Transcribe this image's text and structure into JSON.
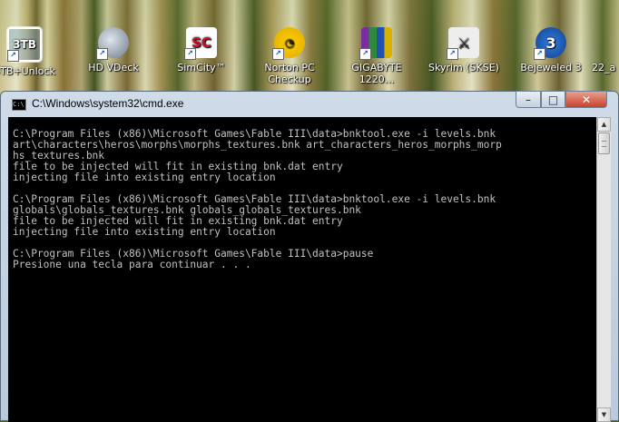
{
  "desktop": {
    "icons": [
      {
        "label": "3TB+Unlock",
        "glyph": "3TB",
        "icon": "3tb-unlock-icon"
      },
      {
        "label": "HD VDeck",
        "glyph": "",
        "icon": "hd-vdeck-icon"
      },
      {
        "label": "SimCity™",
        "glyph": "SC",
        "icon": "simcity-icon"
      },
      {
        "label": "Norton PC Checkup",
        "glyph": "◔",
        "icon": "norton-icon"
      },
      {
        "label": "GIGABYTE 1220...",
        "glyph": "",
        "icon": "gigabyte-icon"
      },
      {
        "label": "Skyrim (SKSE)",
        "glyph": "⚔",
        "icon": "skyrim-icon"
      },
      {
        "label": "Bejeweled 3",
        "glyph": "3",
        "icon": "bejeweled-icon"
      },
      {
        "label": "22_a",
        "glyph": "",
        "icon": "file-icon"
      }
    ]
  },
  "window": {
    "title": "C:\\Windows\\system32\\cmd.exe",
    "title_icon": "C:\\",
    "buttons": {
      "minimize": "–",
      "maximize": "□",
      "close": "✕"
    }
  },
  "console": {
    "text": "C:\\Program Files (x86)\\Microsoft Games\\Fable III\\data>bnktool.exe -i levels.bnk\nart\\characters\\heros\\morphs\\morphs_textures.bnk art_characters_heros_morphs_morp\nhs_textures.bnk\nfile to be injected will fit in existing bnk.dat entry\ninjecting file into existing entry location\n\nC:\\Program Files (x86)\\Microsoft Games\\Fable III\\data>bnktool.exe -i levels.bnk\nglobals\\globals_textures.bnk globals_globals_textures.bnk\nfile to be injected will fit in existing bnk.dat entry\ninjecting file into existing entry location\n\nC:\\Program Files (x86)\\Microsoft Games\\Fable III\\data>pause\nPresione una tecla para continuar . . ."
  },
  "scrollbar": {
    "up": "▲",
    "down": "▼"
  }
}
